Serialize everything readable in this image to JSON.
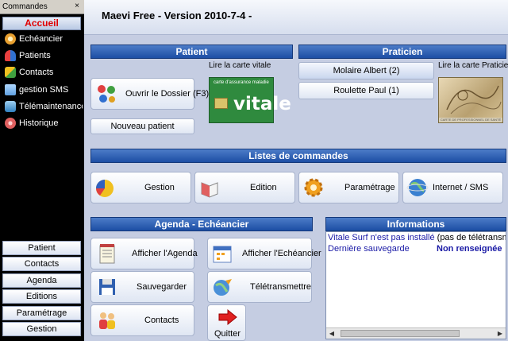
{
  "left_pane": {
    "header": "Commandes",
    "close": "×",
    "accueil": "Accueil",
    "items": [
      {
        "label": "Echéancier",
        "icon": "clock-icon",
        "color": "#e8a030"
      },
      {
        "label": "Patients",
        "icon": "people-icon",
        "color": "#e84040"
      },
      {
        "label": "Contacts",
        "icon": "contacts-icon",
        "color": "#f0c020"
      },
      {
        "label": "gestion SMS",
        "icon": "sms-icon",
        "color": "#60a0e0"
      },
      {
        "label": "Télémaintenance",
        "icon": "network-icon",
        "color": "#40a0d8"
      },
      {
        "label": "Historique",
        "icon": "history-icon",
        "color": "#e06060"
      }
    ],
    "buttons": [
      "Patient",
      "Contacts",
      "Agenda",
      "Editions",
      "Paramétrage",
      "Gestion"
    ]
  },
  "title": "Maevi Free - Version 2010-7-4 -",
  "patient": {
    "header": "Patient",
    "vitale_caption": "Lire la carte vitale",
    "open_dossier": "Ouvrir le Dossier (F3)",
    "new_patient": "Nouveau patient",
    "vitale_card_top": "carte d'assurance maladie",
    "vitale_card_word": "vitale"
  },
  "praticien": {
    "header": "Praticien",
    "cps_caption": "Lire la carte Praticien",
    "practitioners": [
      "Molaire Albert (2)",
      "Roulette Paul (1)"
    ],
    "cps_strip": "CARTE DE PROFESSIONNEL DE SANTÉ"
  },
  "listes": {
    "header": "Listes de commandes",
    "buttons": [
      {
        "label": "Gestion",
        "icon": "pie-chart-icon"
      },
      {
        "label": "Edition",
        "icon": "book-icon"
      },
      {
        "label": "Paramétrage",
        "icon": "gear-icon"
      },
      {
        "label": "Internet / SMS",
        "icon": "globe-icon"
      }
    ]
  },
  "agenda": {
    "header": "Agenda - Echéancier",
    "afficher_agenda": "Afficher l'Agenda",
    "afficher_echeancier": "Afficher l'Echéancier",
    "sauvegarder": "Sauvegarder",
    "teletransmettre": "Télétransmettre",
    "contacts": "Contacts",
    "quitter": "Quitter"
  },
  "informations": {
    "header": "Informations",
    "line1_part1": "Vitale Surf n'est pas installé",
    "line1_part2": "(pas de télétransmi",
    "line2_label": "Dernière sauvegarde",
    "line2_value": "Non renseignée",
    "link_color": "#1a1aa6"
  }
}
